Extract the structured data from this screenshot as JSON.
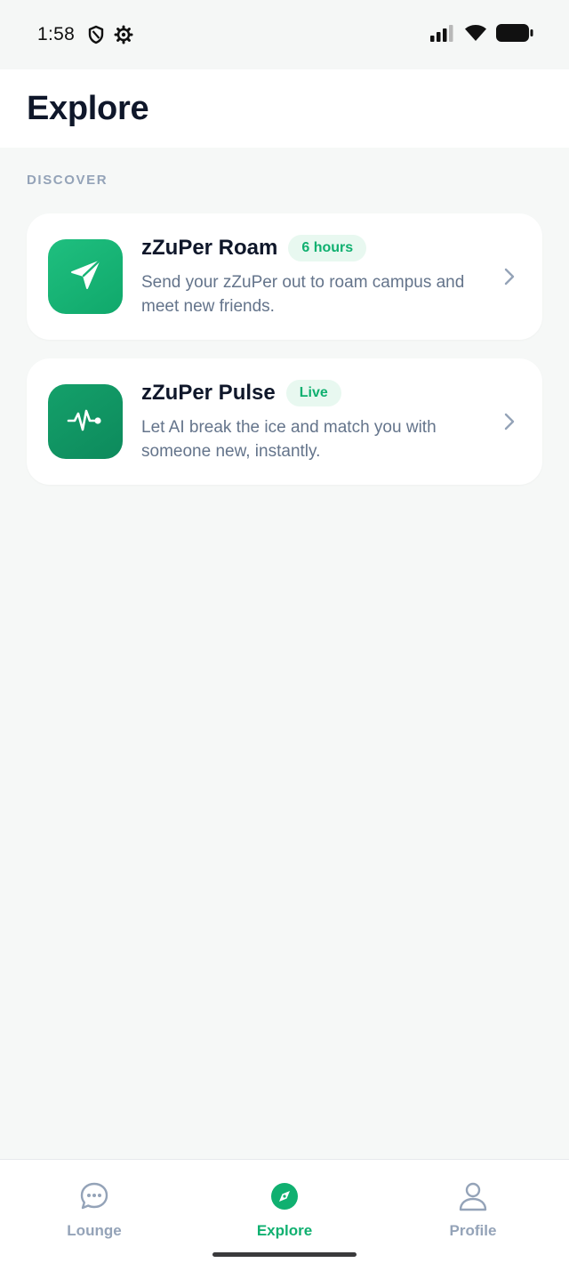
{
  "status_bar": {
    "time": "1:58",
    "left_icons": [
      "shield-icon",
      "gear-icon"
    ],
    "right_icons": [
      "signal-icon",
      "wifi-icon",
      "battery-icon"
    ]
  },
  "header": {
    "title": "Explore"
  },
  "section": {
    "label": "DISCOVER"
  },
  "cards": [
    {
      "title": "zZuPer Roam",
      "badge": "6 hours",
      "description": "Send your zZuPer out to roam campus and meet new friends.",
      "icon": "paper-plane-icon"
    },
    {
      "title": "zZuPer Pulse",
      "badge": "Live",
      "description": "Let AI break the ice and match you with someone new, instantly.",
      "icon": "pulse-icon"
    }
  ],
  "bottom_nav": {
    "items": [
      {
        "label": "Lounge",
        "icon": "chat-bubble-icon",
        "active": false
      },
      {
        "label": "Explore",
        "icon": "compass-icon",
        "active": true
      },
      {
        "label": "Profile",
        "icon": "person-icon",
        "active": false
      }
    ]
  },
  "colors": {
    "accent": "#10b070",
    "badge_bg": "#e8f8f0",
    "title": "#0f172a",
    "muted": "#64748b",
    "inactive_nav": "#94a3b8",
    "background": "#f6f8f7"
  }
}
